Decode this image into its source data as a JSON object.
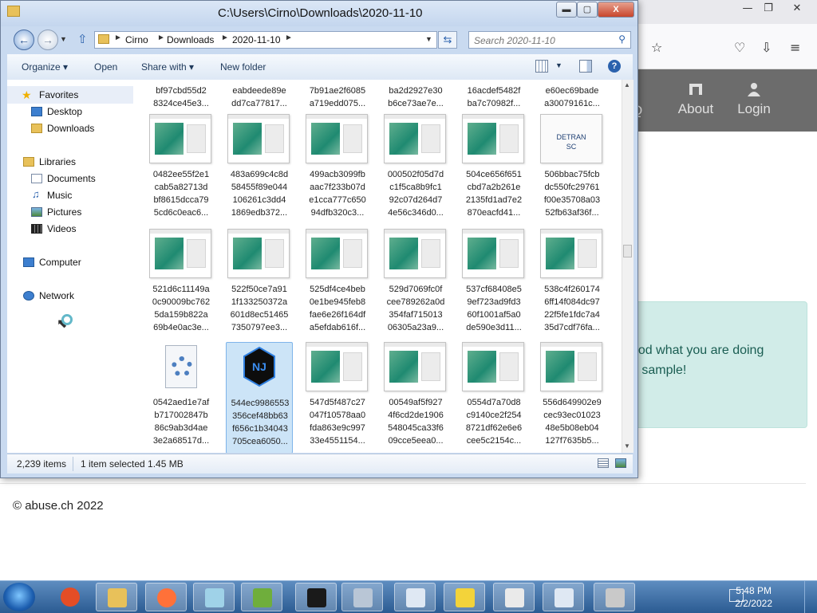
{
  "browser": {
    "nav": {
      "about": "About",
      "login": "Login",
      "q_fragment": "Q"
    },
    "alert": {
      "line1": "ood what you are doing",
      "line2": "e sample!"
    },
    "footer": "© abuse.ch 2022",
    "window_controls": {
      "min": "—",
      "max": "❐",
      "close": "✕"
    }
  },
  "explorer": {
    "title": "C:\\Users\\Cirno\\Downloads\\2020-11-10",
    "window_controls": {
      "min": "▬",
      "max": "▢",
      "close": "X"
    },
    "address": [
      "Cirno",
      "Downloads",
      "2020-11-10"
    ],
    "search_placeholder": "Search 2020-11-10",
    "toolbar": {
      "organize": "Organize ▾",
      "open": "Open",
      "share_with": "Share with ▾",
      "new_folder": "New folder"
    },
    "nav_pane": {
      "favorites": "Favorites",
      "desktop": "Desktop",
      "downloads": "Downloads",
      "libraries": "Libraries",
      "documents": "Documents",
      "music": "Music",
      "pictures": "Pictures",
      "videos": "Videos",
      "computer": "Computer",
      "network": "Network"
    },
    "top_partial_row": [
      "bf97cbd55d2\n8324ce45e3...",
      "eabdeede89e\ndd7ca77817...",
      "7b91ae2f6085\na719edd075...",
      "ba2d2927e30\nb6ce73ae7e...",
      "16acdef5482f\nba7c70982f...",
      "e60ec69bade\na30079161c..."
    ],
    "files": [
      {
        "name": "0482ee55f2e1\ncab5a82713d\nbf8615dcca79\n5cd6c0eac6...",
        "kind": "thumb"
      },
      {
        "name": "483a699c4c8d\n58455f89e044\n106261c3dd4\n1869edb372...",
        "kind": "thumb"
      },
      {
        "name": "499acb3099fb\naac7f233b07d\ne1cca777c650\n94dfb320c3...",
        "kind": "thumb"
      },
      {
        "name": "000502f05d7d\nc1f5ca8b9fc1\n92c07d264d7\n4e56c346d0...",
        "kind": "thumb"
      },
      {
        "name": "504ce656f651\ncbd7a2b261e\n2135fd1ad7e2\n870eacfd41...",
        "kind": "thumb"
      },
      {
        "name": "506bbac75fcb\ndc550fc29761\nf00e35708a03\n52fb63af36f...",
        "kind": "detran",
        "thumb_text": "DETRAN SC"
      },
      {
        "name": "521d6c11149a\n0c90009bc762\n5da159b822a\n69b4e0ac3e...",
        "kind": "thumb"
      },
      {
        "name": "522f50ce7a91\n1f133250372a\n601d8ec51465\n7350797ee3...",
        "kind": "thumb"
      },
      {
        "name": "525df4ce4beb\n0e1be945feb8\nfae6e26f164df\na5efdab616f...",
        "kind": "thumb"
      },
      {
        "name": "529d7069fc0f\ncee789262a0d\n354faf715013\n06305a23a9...",
        "kind": "thumb"
      },
      {
        "name": "537cf68408e5\n9ef723ad9fd3\n60f1001af5a0\nde590e3d11...",
        "kind": "thumb"
      },
      {
        "name": "538c4f260174\n6ff14f084dc97\n22f5fe1fdc7a4\n35d7cdf76fa...",
        "kind": "thumb"
      },
      {
        "name": "0542aed1e7af\nb717002847b\n86c9ab3d4ae\n3e2a68517d...",
        "kind": "gear"
      },
      {
        "name": "544ec9986553\n356cef48bb63\nf656c1b34043\n705cea6050...",
        "kind": "nj",
        "thumb_text": "NJ"
      },
      {
        "name": "547d5f487c27\n047f10578aa0\nfda863e9c997\n33e4551154...",
        "kind": "thumb"
      },
      {
        "name": "00549af5f927\n4f6cd2de1906\n548045ca33f6\n09cce5eea0...",
        "kind": "thumb"
      },
      {
        "name": "0554d7a70d8\nc9140ce2f254\n8721df62e6e6\ncee5c2154c...",
        "kind": "thumb"
      },
      {
        "name": "556d649902e9\ncec93ec01023\n48e5b08eb04\n127f7635b5...",
        "kind": "thumb"
      }
    ],
    "selected_index": 13,
    "status": {
      "count": "2,239 items",
      "selected": "1 item selected  1.45 MB"
    }
  },
  "taskbar": {
    "time": "5:48 PM",
    "date": "2/2/2022",
    "items": [
      "chrome-icon",
      "explorer-icon",
      "firefox-icon",
      "notepad-icon",
      "notepadpp-icon",
      "7zip-icon",
      "app-icon",
      "window-icon",
      "shield-icon",
      "document-icon",
      "window-icon-2",
      "package-icon"
    ]
  },
  "colors": {
    "title_bg": "#c9daf0",
    "accent": "#2b62ad",
    "selected": "#cce4f7",
    "taskbar": "#2b5b92"
  }
}
